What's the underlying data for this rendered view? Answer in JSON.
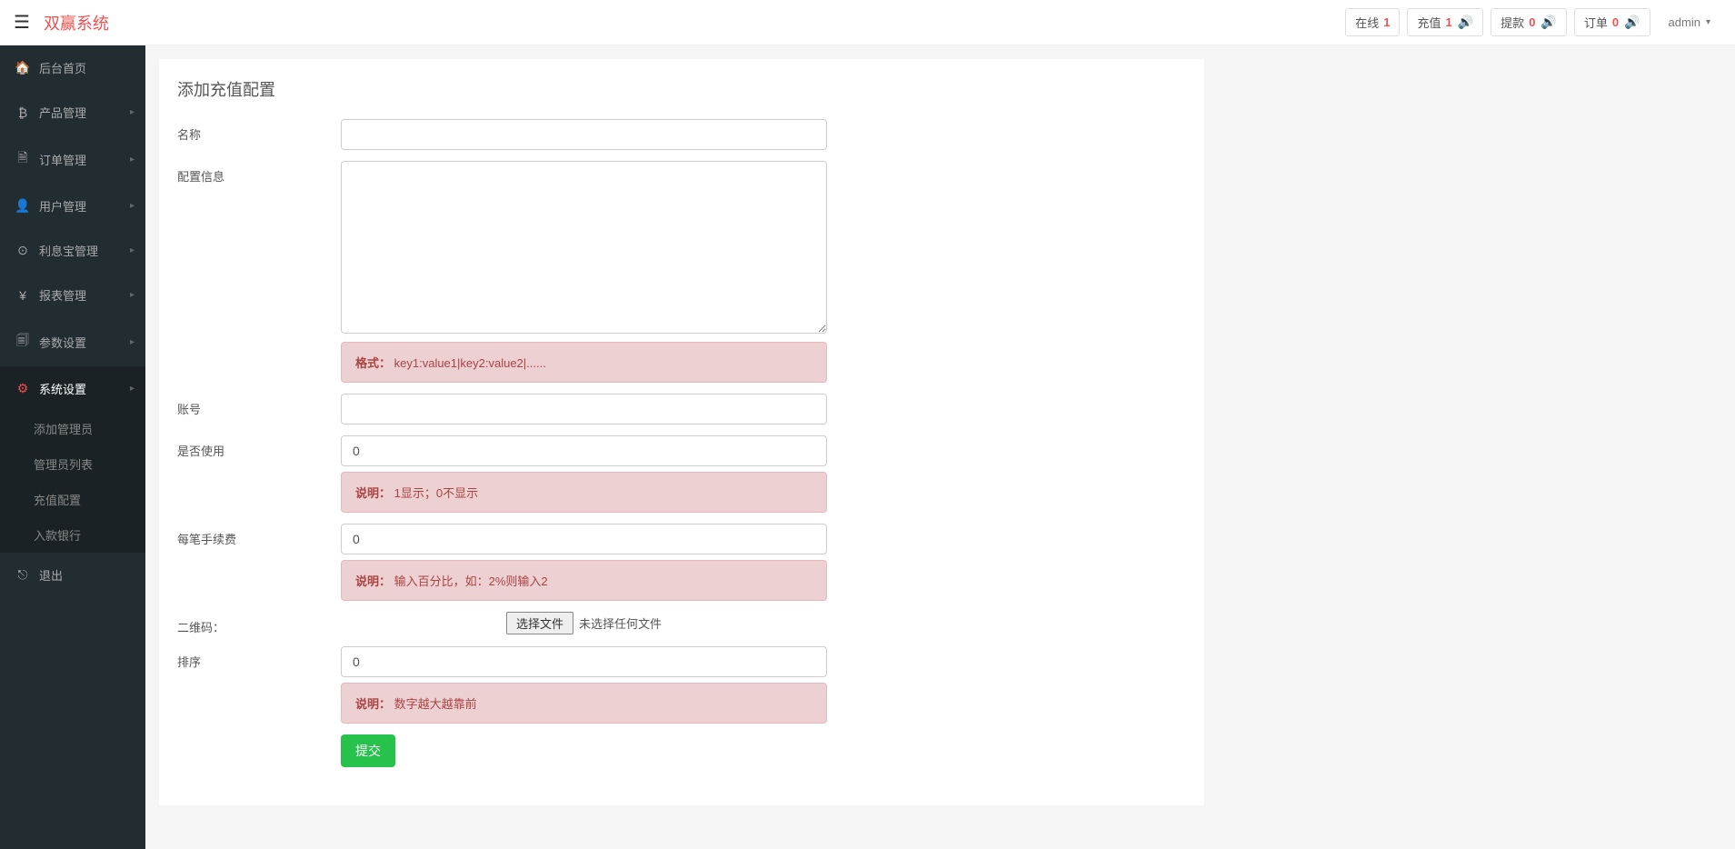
{
  "brand": "双赢系统",
  "header": {
    "online_label": "在线",
    "online_count": "1",
    "recharge_label": "充值",
    "recharge_count": "1",
    "withdraw_label": "提款",
    "withdraw_count": "0",
    "order_label": "订单",
    "order_count": "0",
    "admin_name": "admin"
  },
  "sidebar": {
    "home": "后台首页",
    "product": "产品管理",
    "order": "订单管理",
    "user": "用户管理",
    "interest": "利息宝管理",
    "report": "报表管理",
    "params": "参数设置",
    "system": "系统设置",
    "sub_add_admin": "添加管理员",
    "sub_admin_list": "管理员列表",
    "sub_recharge_config": "充值配置",
    "sub_deposit_bank": "入款银行",
    "logout": "退出"
  },
  "page": {
    "title": "添加充值配置",
    "labels": {
      "name": "名称",
      "config_info": "配置信息",
      "account": "账号",
      "is_use": "是否使用",
      "per_fee": "每笔手续费",
      "qrcode": "二维码：",
      "sort": "排序"
    },
    "hints": {
      "format_label": "格式：",
      "format_text": "key1:value1|key2:value2|......",
      "display_label": "说明：",
      "display_text": "1显示；0不显示",
      "percent_label": "说明：",
      "percent_text": "输入百分比，如：2%则输入2",
      "sort_label": "说明：",
      "sort_text": "数字越大越靠前"
    },
    "values": {
      "name": "",
      "config_info": "",
      "account": "",
      "is_use": "0",
      "per_fee": "0",
      "sort": "0"
    },
    "file_button": "选择文件",
    "file_none": "未选择任何文件",
    "submit": "提交"
  }
}
